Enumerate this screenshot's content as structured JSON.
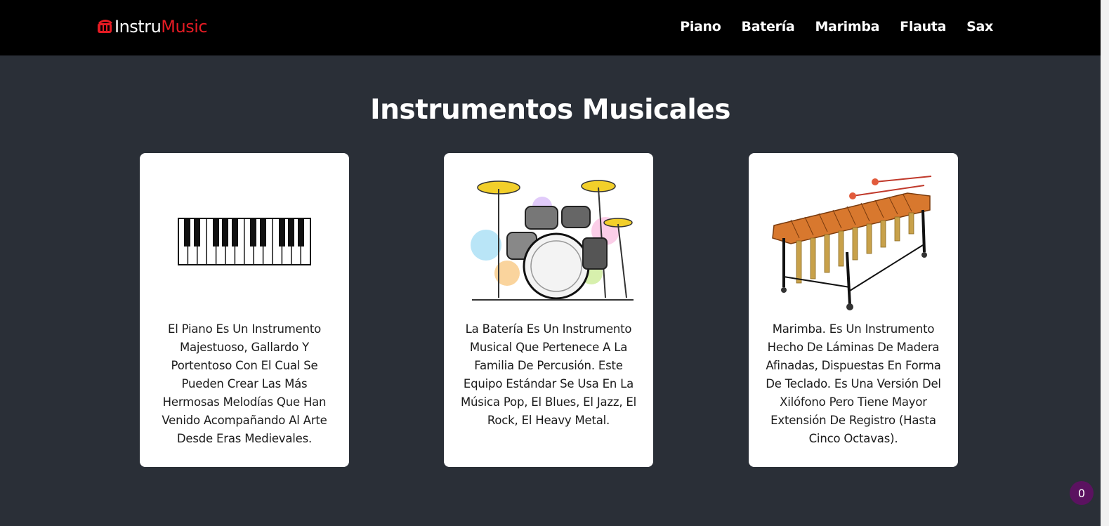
{
  "brand": {
    "part1": "Instru",
    "part2": "Music",
    "accent": "#e31b23"
  },
  "nav": [
    {
      "label": "Piano"
    },
    {
      "label": "Batería"
    },
    {
      "label": "Marimba"
    },
    {
      "label": "Flauta"
    },
    {
      "label": "Sax"
    }
  ],
  "main": {
    "title": "Instrumentos Musicales",
    "cards": [
      {
        "image": "piano-keyboard-image",
        "text": "El Piano Es Un Instrumento Majestuoso, Gallardo Y Portentoso Con El Cual Se Pueden Crear Las Más Hermosas Melodías Que Han Venido Acompañando Al Arte Desde Eras Medievales."
      },
      {
        "image": "drum-kit-image",
        "text": "La Batería Es Un Instrumento Musical Que Pertenece A La Familia De Percusión. Este Equipo Estándar Se Usa En La Música Pop, El Blues, El Jazz, El Rock, El Heavy Metal."
      },
      {
        "image": "marimba-image",
        "text": "Marimba. Es Un Instrumento Hecho De Láminas De Madera Afinadas, Dispuestas En Forma De Teclado. Es Una Versión Del Xilófono Pero Tiene Mayor Extensión De Registro (Hasta Cinco Octavas)."
      }
    ]
  },
  "cart_badge": {
    "count": "0",
    "color": "#5b1260"
  }
}
